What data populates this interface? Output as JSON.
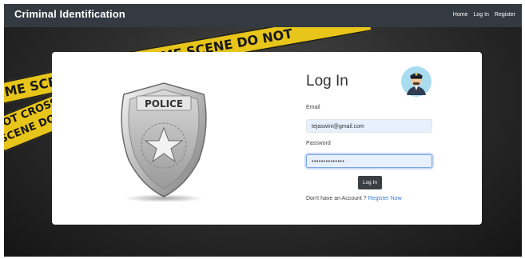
{
  "navbar": {
    "brand": "Criminal Identification",
    "links": [
      "Home",
      "Log In",
      "Register"
    ]
  },
  "background": {
    "tape_texts": [
      "CROSS CRIME SCENE DO NOT",
      "RIME SCE",
      "NOT CROSS SCENE DO"
    ]
  },
  "login": {
    "title": "Log In",
    "badge_text": "POLICE",
    "email_label": "Email",
    "email_value": "tejaswini@gmail.com",
    "password_label": "Password",
    "password_value": "••••••••••••••",
    "button_label": "Log In",
    "signup_prompt": "Don't have an Account ?",
    "signup_link": "Register Now"
  },
  "colors": {
    "navbar_bg": "#333a41",
    "tape": "#e8c51a",
    "button_bg": "#3a3f44",
    "link": "#3b7dd8",
    "input_bg": "#e8f0fe"
  }
}
